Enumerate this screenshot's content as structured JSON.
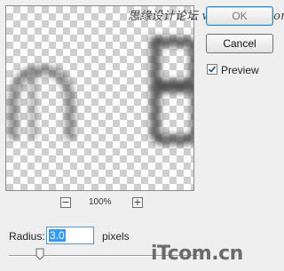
{
  "preview": {
    "zoom_out_label": "−",
    "zoom_value": "100%",
    "zoom_in_label": "+"
  },
  "buttons": {
    "ok_label": "OK",
    "cancel_label": "Cancel"
  },
  "preview_toggle": {
    "label": "Preview",
    "checked": true
  },
  "radius": {
    "label": "Radius:",
    "value": "3.0",
    "unit": "pixels"
  },
  "watermarks": {
    "top": "思缘设计论坛 www.Psjia.com",
    "bottom": "iTcom.cn"
  },
  "colors": {
    "accent": "#3399ff",
    "dialog_bg": "#efefef"
  }
}
